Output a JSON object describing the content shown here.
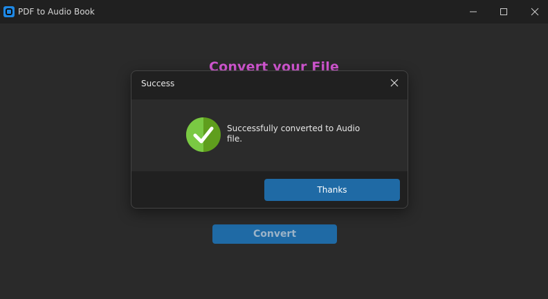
{
  "window": {
    "title": "PDF to Audio Book",
    "icon": "app-logo-icon",
    "controls": [
      "minimize-icon",
      "maximize-icon",
      "close-icon"
    ]
  },
  "main": {
    "heading": "Convert your File",
    "convert_button": "Convert"
  },
  "dialog": {
    "title": "Success",
    "message": "Successfully converted to Audio file.",
    "icon": "checkmark-success-icon",
    "button": "Thanks"
  },
  "colors": {
    "heading": "#d457d4",
    "button": "#1f6aa5",
    "success": "#7ac943"
  }
}
